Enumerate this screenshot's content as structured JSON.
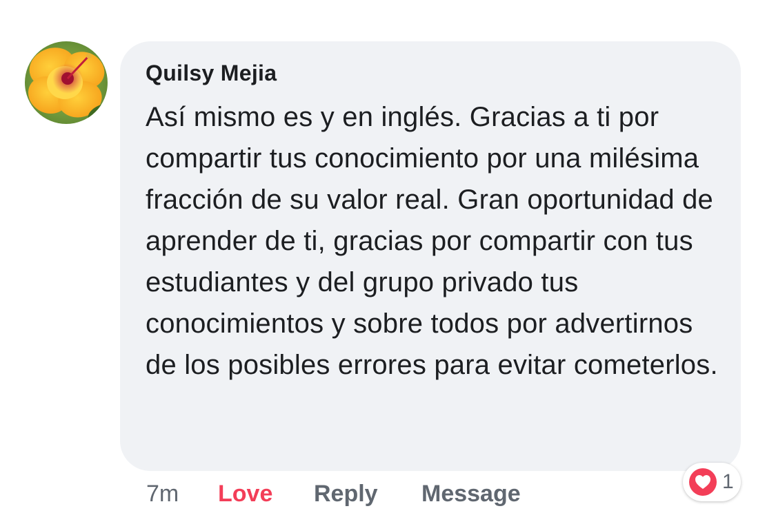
{
  "comment": {
    "author": "Quilsy Mejia",
    "text": "Así mismo es y en inglés. Gracias a ti por compartir tus conocimiento por una milésima fracción de su valor real. Gran oportunidad de aprender de ti, gracias por compartir con tus estudiantes y del grupo privado tus conocimientos y sobre todos por advertirnos de los posibles errores para evitar cometerlos.",
    "avatar_icon": "hibiscus-flower-avatar"
  },
  "actions": {
    "time": "7m",
    "love_label": "Love",
    "reply_label": "Reply",
    "message_label": "Message"
  },
  "reactions": {
    "icon": "heart-icon",
    "count": "1"
  },
  "colors": {
    "bubble_bg": "#f0f2f5",
    "love_red": "#f33e58",
    "secondary_text": "#606770",
    "primary_text": "#1c1e21"
  }
}
